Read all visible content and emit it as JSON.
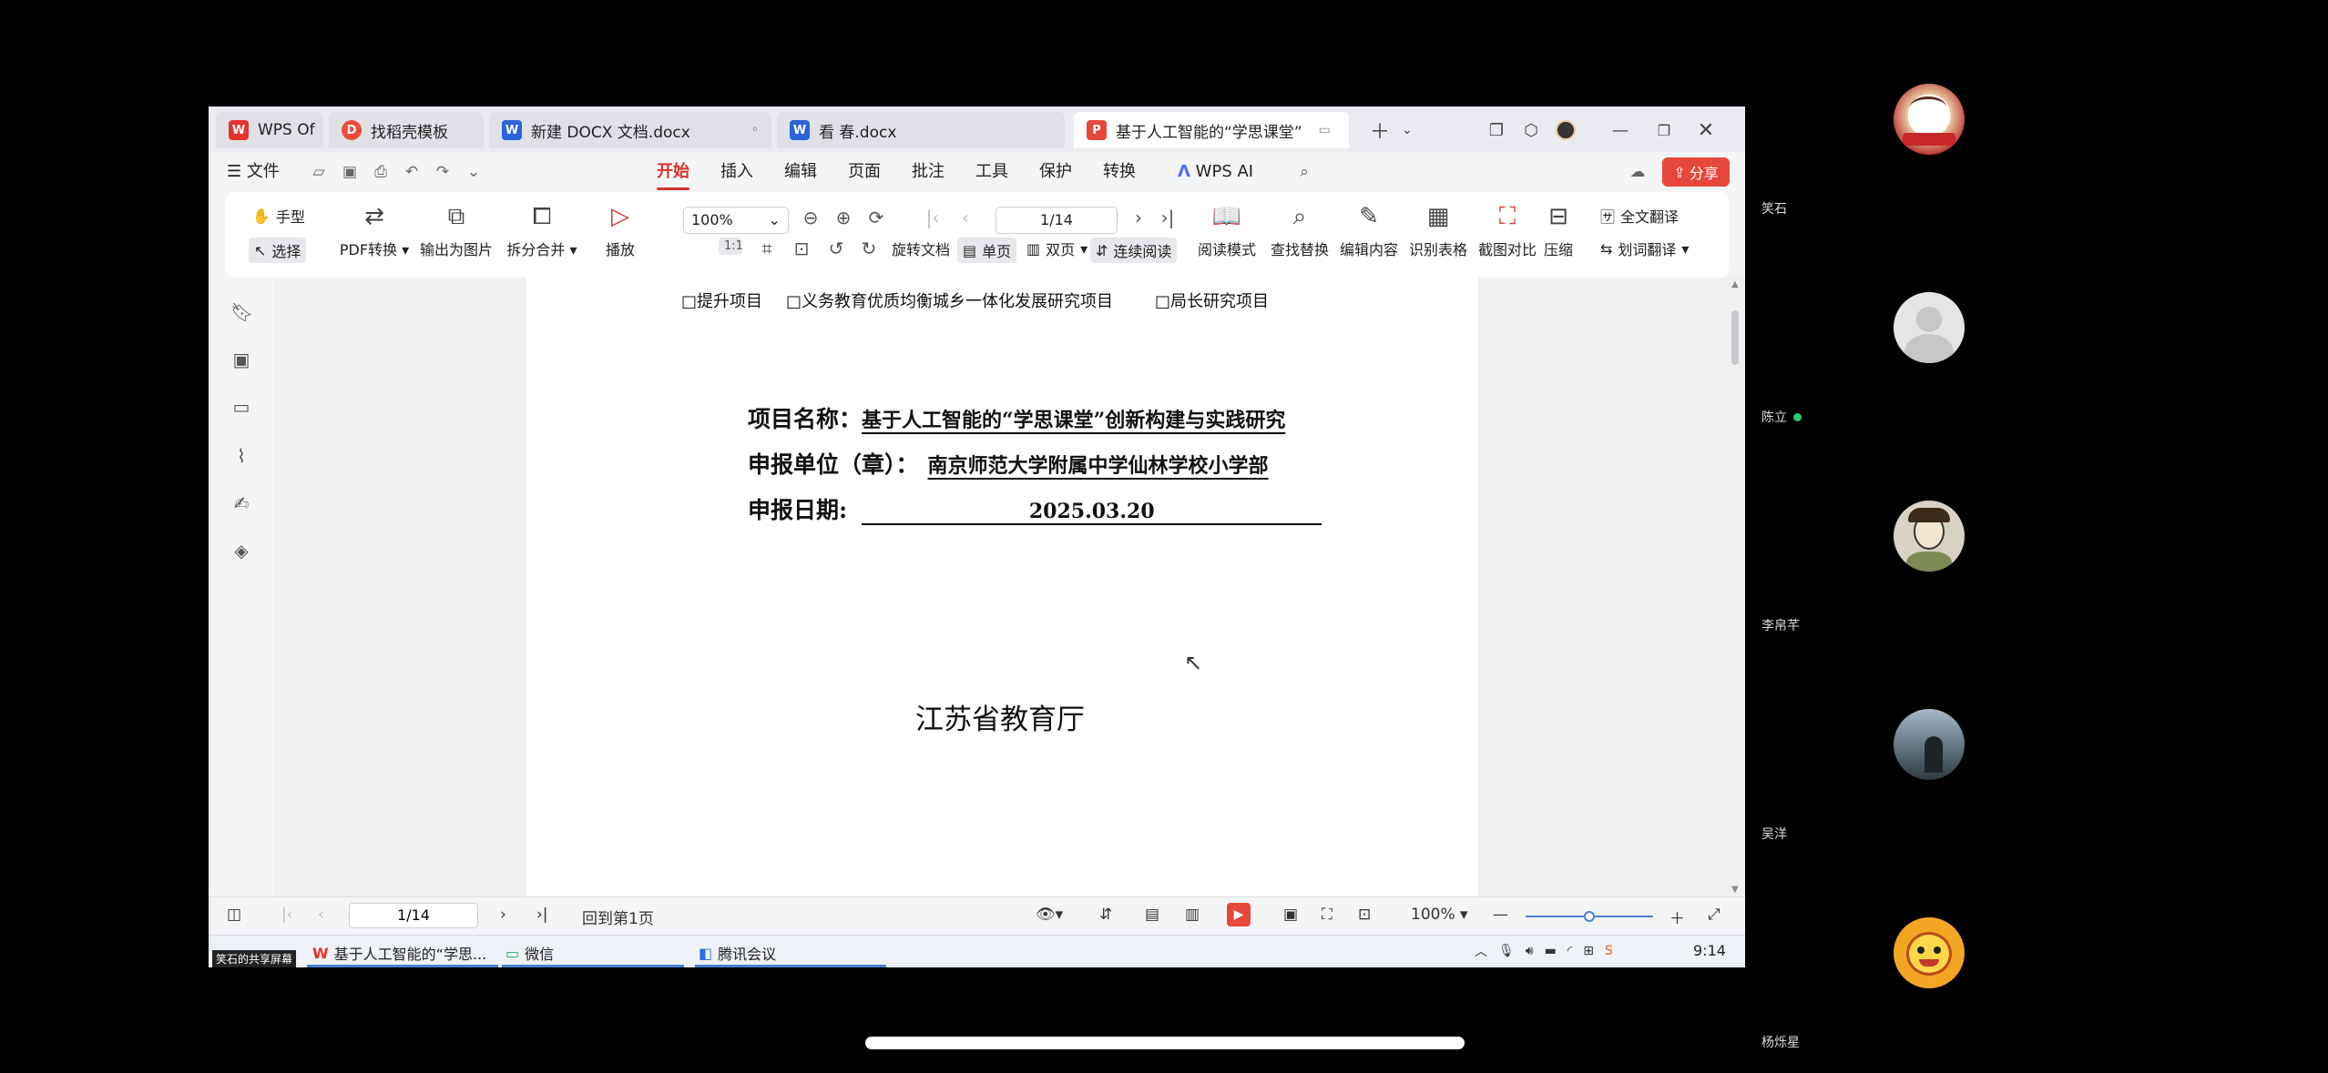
{
  "tabs": [
    {
      "label": "WPS Of",
      "icon": "wps-logo"
    },
    {
      "label": "找稻壳模板",
      "icon": "docer-logo"
    },
    {
      "label": "新建 DOCX 文档.docx",
      "icon": "word-doc"
    },
    {
      "label": "看 春.docx",
      "icon": "word-doc"
    },
    {
      "label": "基于人工智能的“学思课堂”",
      "icon": "pdf-doc"
    }
  ],
  "menu": {
    "file": "文件",
    "items": [
      "开始",
      "插入",
      "编辑",
      "页面",
      "批注",
      "工具",
      "保护",
      "转换",
      "WPS AI"
    ],
    "active": "开始",
    "share": "分享"
  },
  "ribbon": {
    "hand": "手型",
    "select": "选择",
    "pdf_convert": "PDF转换",
    "export_image": "输出为图片",
    "split_merge": "拆分合并",
    "play": "播放",
    "zoom": "100%",
    "page": "1/14",
    "rotate": "旋转文档",
    "single": "单页",
    "double": "双页",
    "continuous": "连续阅读",
    "read_mode": "阅读模式",
    "find_replace": "查找替换",
    "edit_content": "编辑内容",
    "recognize_table": "识别表格",
    "screenshot_compare": "截图对比",
    "compress": "压缩",
    "full_translate": "全文翻译",
    "word_translate": "划词翻译"
  },
  "document": {
    "project_types": [
      "□提升项目",
      "□义务教育优质均衡城乡一体化发展研究项目",
      "□局长研究项目"
    ],
    "name_label": "项目名称：",
    "name_value": "基于人工智能的“学思课堂”创新构建与实践研究",
    "unit_label": "申报单位（章）：",
    "unit_value": "南京师范大学附属中学仙林学校小学部",
    "date_label": "申报日期:",
    "date_value": "2025.03.20",
    "issuer": "江苏省教育厅"
  },
  "statusbar": {
    "page": "1/14",
    "back": "回到第1页",
    "zoom": "100%"
  },
  "taskbar": {
    "share_badge": "笑石的共享屏幕",
    "items": [
      "基于人工智能的“学思...",
      "微信",
      "腾讯会议"
    ],
    "time": "9:14"
  },
  "participants": [
    {
      "name": "笑石"
    },
    {
      "name": "陈立"
    },
    {
      "name": "李帛芊"
    },
    {
      "name": "吴洋"
    },
    {
      "name": "杨烁星"
    }
  ],
  "colors": {
    "accent": "#d4342c",
    "share_button": "#e5483b",
    "online_dot": "#2ecc71"
  }
}
